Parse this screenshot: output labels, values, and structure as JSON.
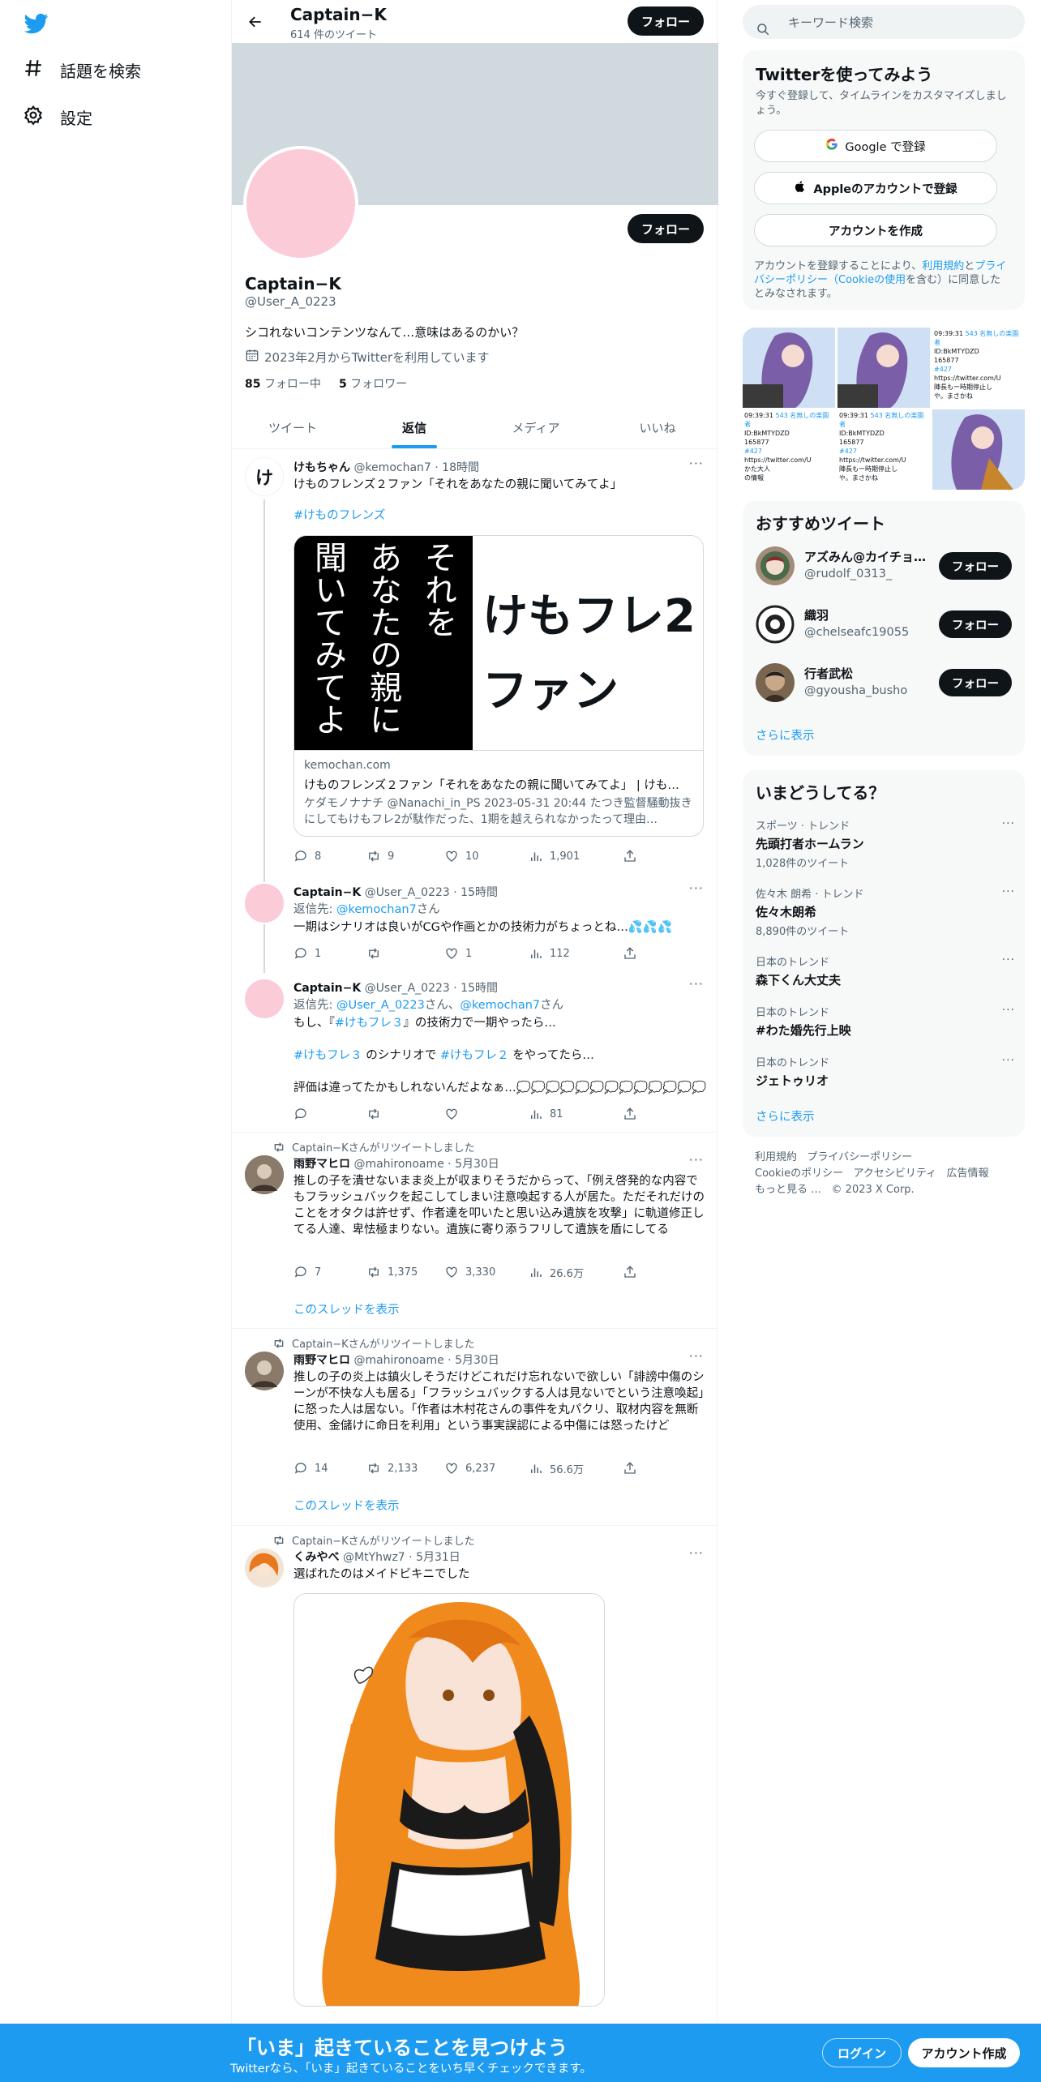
{
  "colors": {
    "accent": "#1d9bf0",
    "text": "#0f1419",
    "muted": "#536471",
    "banner": "#cfd9de",
    "avatar_pink": "#fbcbd8"
  },
  "nav": {
    "explore": "話題を検索",
    "settings": "設定"
  },
  "topbar": {
    "title": "Captain−K",
    "subtitle": "614 件のツイート",
    "follow": "フォロー"
  },
  "profile": {
    "name": "Captain−K",
    "handle": "@User_A_0223",
    "bio": "シコれないコンテンツなんて…意味はあるのかい？",
    "joined": "2023年2月からTwitterを利用しています",
    "following_count": "85",
    "following_label": "フォロー中",
    "followers_count": "5",
    "followers_label": "フォロワー",
    "follow": "フォロー"
  },
  "tabs": [
    "ツイート",
    "返信",
    "メディア",
    "いいね"
  ],
  "tweets": [
    {
      "name": "けもちゃん",
      "handle": "@kemochan7",
      "time": "· 18時間",
      "text": "けものフレンズ２ファン「それをあなたの親に聞いてみてよ」",
      "hashtag": "#けものフレンズ",
      "avatar_char": "け",
      "card": {
        "vertical": [
          "それを",
          "あなたの親に",
          "聞いてみてよ"
        ],
        "big1": "けもフレ2",
        "big2": "ファン",
        "domain": "kemochan.com",
        "title": "けものフレンズ２ファン「それをあなたの親に聞いてみてよ」 | けも…",
        "desc": "ケダモノナナチ @Nanachi_in_PS 2023-05-31 20:44 たつき監督騒動抜きにしてもけもフレ2が駄作だった、1期を越えられなかったって理由…"
      },
      "replies": "8",
      "retweets": "9",
      "likes": "10",
      "views": "1,901"
    },
    {
      "name": "Captain−K",
      "handle": "@User_A_0223",
      "time": "· 15時間",
      "reply_to_label": "返信先:",
      "reply_to": "@kemochan7",
      "reply_suffix": "さん",
      "text": "一期はシナリオは良いがCGや作画とかの技術力がちょっとね…💦💦💦",
      "replies": "1",
      "retweets": "",
      "likes": "1",
      "views": "112"
    },
    {
      "name": "Captain−K",
      "handle": "@User_A_0223",
      "time": "· 15時間",
      "reply_to_label": "返信先:",
      "reply_to": "@User_A_0223",
      "reply_mid": "さん、",
      "reply_to2": "@kemochan7",
      "reply_suffix": "さん",
      "line1_a": "もし、『",
      "line1_tag": "#けもフレ３",
      "line1_b": "』の技術力で一期やったら…",
      "line2_tag1": "#けもフレ３",
      "line2_mid": " のシナリオで ",
      "line2_tag2": "#けもフレ２",
      "line2_end": " をやってたら…",
      "line3": "評価は違ってたかもしれないんだよなぁ…💭💭💭💭💭💭💭💭💭💭💭💭💭",
      "replies": "",
      "retweets": "",
      "likes": "",
      "views": "81"
    },
    {
      "retweet_label": "Captain−Kさんがリツイートしました",
      "name": "雨野マヒロ",
      "handle": "@mahironoame",
      "time": "· 5月30日",
      "text": "推しの子を潰せないまま炎上が収まりそうだからって、「例え啓発的な内容でもフラッシュバックを起こしてしまい注意喚起する人が居た。ただそれだけのことをオタクは許せず、作者達を叩いたと思い込み遺族を攻撃」に軌道修正してる人達、卑怯極まりない。遺族に寄り添うフリして遺族を盾にしてる",
      "replies": "7",
      "retweets": "1,375",
      "likes": "3,330",
      "views": "26.6万",
      "show_thread": "このスレッドを表示"
    },
    {
      "retweet_label": "Captain−Kさんがリツイートしました",
      "name": "雨野マヒロ",
      "handle": "@mahironoame",
      "time": "· 5月30日",
      "text": "推しの子の炎上は鎮火しそうだけどこれだけ忘れないで欲しい「誹謗中傷のシーンが不快な人も居る」「フラッシュバックする人は見ないでという注意喚起」に怒った人は居ない。「作者は木村花さんの事件を丸パクリ、取材内容を無断使用、金儲けに命日を利用」という事実誤認による中傷には怒ったけど",
      "replies": "14",
      "retweets": "2,133",
      "likes": "6,237",
      "views": "56.6万",
      "show_thread": "このスレッドを表示"
    },
    {
      "retweet_label": "Captain−Kさんがリツイートしました",
      "name": "くみやべ",
      "handle": "@MtYhwz7",
      "time": "· 5月31日",
      "text": "選ばれたのはメイドビキニでした"
    }
  ],
  "right": {
    "search_placeholder": "キーワード検索",
    "signup": {
      "title": "Twitterを使ってみよう",
      "desc": "今すぐ登録して、タイムラインをカスタマイズしましょう。",
      "google": "Google で登録",
      "apple": "Appleのアカウントで登録",
      "create": "アカウントを作成",
      "terms_a": "アカウントを登録することにより、",
      "terms_link1": "利用規約",
      "terms_b": "と",
      "terms_link2": "プライバシーポリシー（Cookieの使用",
      "terms_c": "を含む）に同意したとみなされます。"
    },
    "thumb_texts": {
      "t1": "543 名無しの楽園者",
      "t2": "ID:BkMTYDZD",
      "t3": "165877",
      "t4": "#427",
      "t5": "https://twitter.com/U",
      "t6": "陣長もー時期停止し",
      "t7": "や。まさかね",
      "t8": "かた大人",
      "t9": "の情報",
      "t10": "09:39:31"
    },
    "suggest": {
      "title": "おすすめツイート",
      "users": [
        {
          "name": "アズみん@カイチョ…",
          "handle": "@rudolf_0313_"
        },
        {
          "name": "織羽",
          "handle": "@chelseafc19055"
        },
        {
          "name": "行者武松",
          "handle": "@gyousha_busho"
        }
      ],
      "follow": "フォロー",
      "more": "さらに表示"
    },
    "trends": {
      "title": "いまどうしてる？",
      "items": [
        {
          "ctx": "スポーツ · トレンド",
          "name": "先頭打者ホームラン",
          "count": "1,028件のツイート"
        },
        {
          "ctx": "佐々木 朗希 · トレンド",
          "name": "佐々木朗希",
          "count": "8,890件のツイート"
        },
        {
          "ctx": "日本のトレンド",
          "name": "森下くん大丈夫",
          "count": ""
        },
        {
          "ctx": "日本のトレンド",
          "name": "#わた婚先行上映",
          "count": ""
        },
        {
          "ctx": "日本のトレンド",
          "name": "ジェトゥリオ",
          "count": ""
        }
      ],
      "more": "さらに表示"
    },
    "footer": {
      "terms": "利用規約",
      "privacy": "プライバシーポリシー",
      "cookie": "Cookieのポリシー",
      "a11y": "アクセシビリティ",
      "ads": "広告情報",
      "more": "もっと見る …",
      "copy": "© 2023 X Corp."
    }
  },
  "bottom": {
    "title": "「いま」起きていることを見つけよう",
    "sub": "Twitterなら、「いま」起きていることをいち早くチェックできます。",
    "login": "ログイン",
    "signup": "アカウント作成"
  }
}
